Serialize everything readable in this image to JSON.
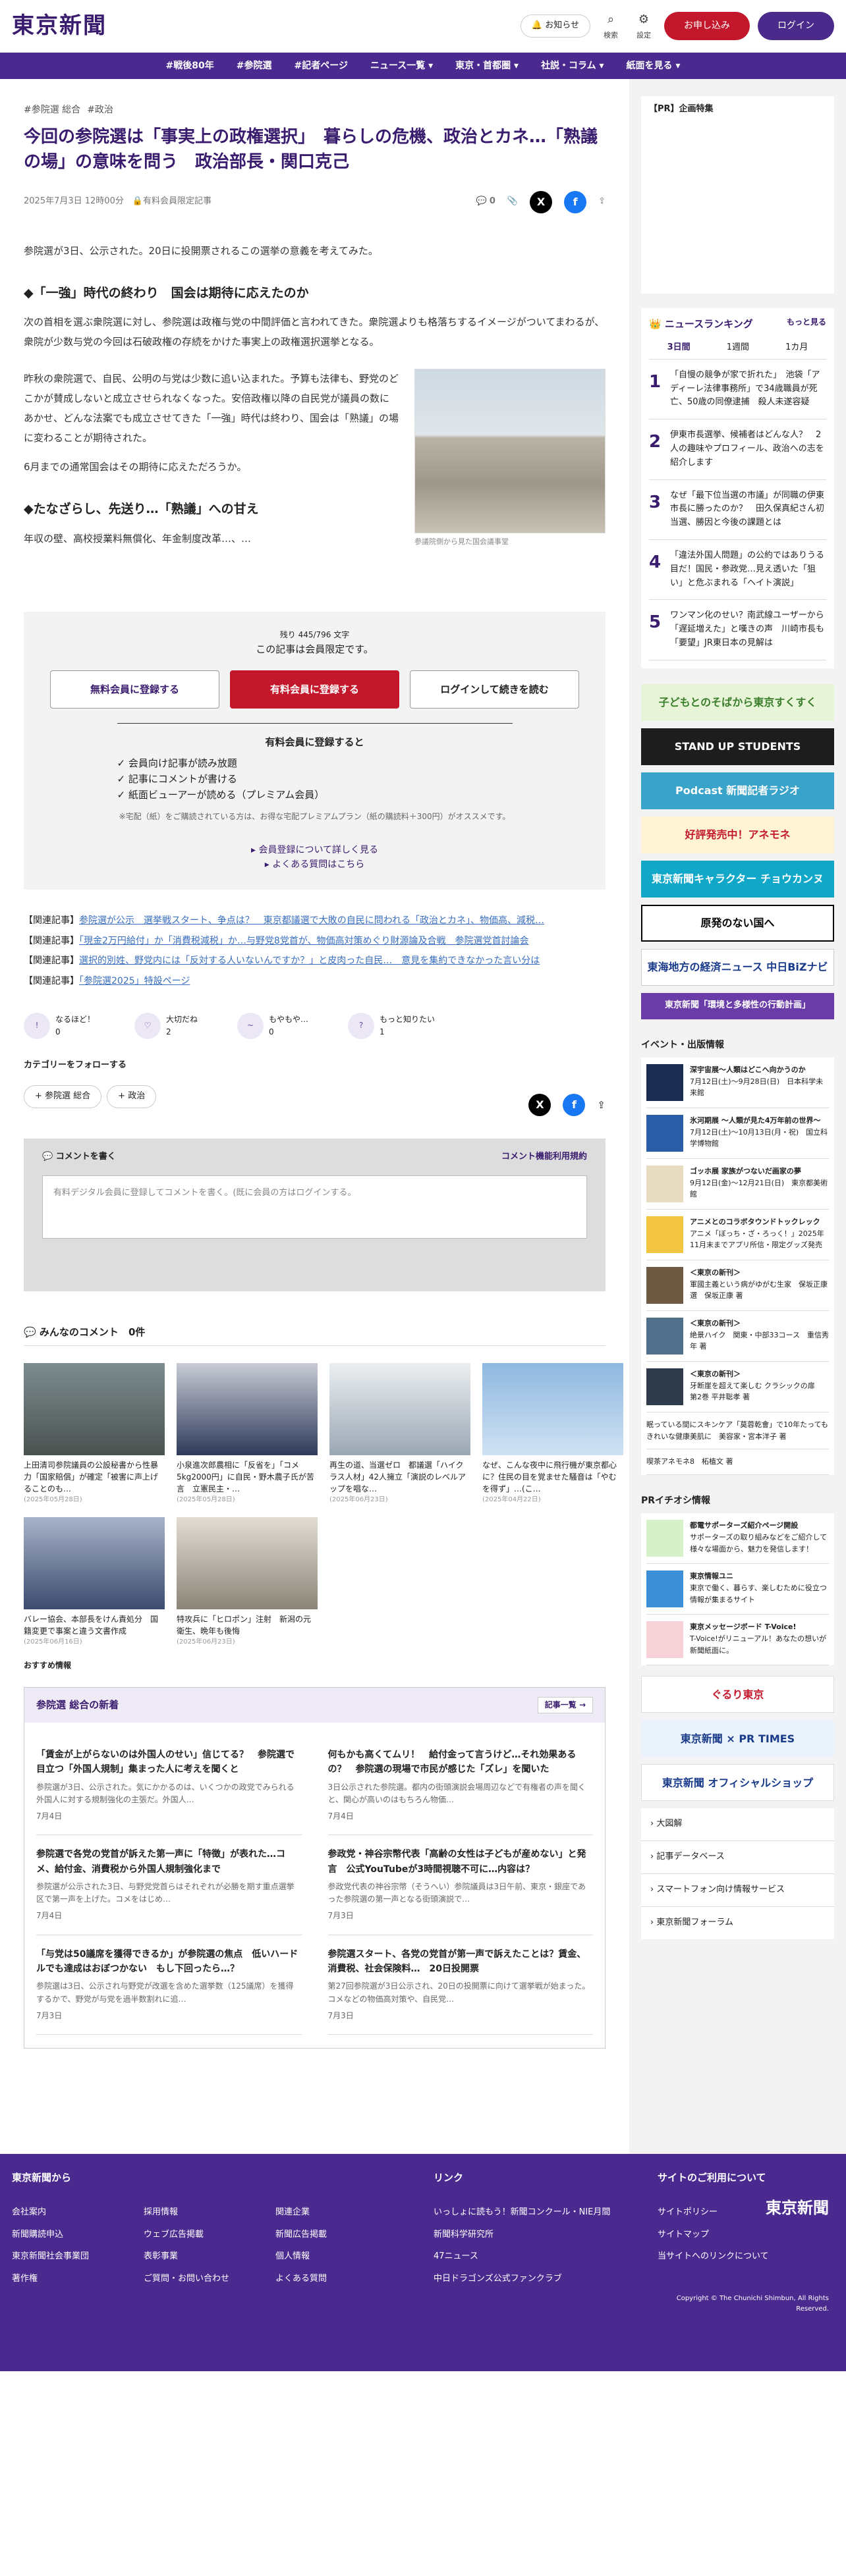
{
  "header": {
    "logo": "東京新聞",
    "notice": "お知らせ",
    "search": "検索",
    "settings": "設定",
    "signup": "お申し込み",
    "login": "ログイン"
  },
  "nav": [
    "#戦後80年",
    "#参院選",
    "#記者ページ",
    "ニュース一覧 ▾",
    "東京・首都圏 ▾",
    "社説・コラム ▾",
    "紙面を見る ▾"
  ],
  "article": {
    "tags": [
      "#参院選 総合",
      "#政治"
    ],
    "title": "今回の参院選は「事実上の政権選択」　暮らしの危機、政治とカネ…「熟議の場」の意味を問う　政治部長・関口克己",
    "date": "2025年7月3日 12時00分",
    "member": "有料会員限定記事",
    "comments": "0",
    "lead": "参院選が3日、公示された。20日に投開票されるこの選挙の意義を考えてみた。",
    "h1": "◆「一強」時代の終わり　国会は期待に応えたのか",
    "p1": "次の首相を選ぶ衆院選に対し、参院選は政権与党の中間評価と言われてきた。衆院選よりも格落ちするイメージがついてまわるが、衆院が少数与党の今回は石破政権の存続をかけた事実上の政権選択選挙となる。",
    "p2": "昨秋の衆院選で、自民、公明の与党は少数に追い込まれた。予算も法律も、野党のどこかが賛成しないと成立させられなくなった。安倍政権以降の自民党が議員の数にあかせ、どんな法案でも成立させてきた「一強」時代は終わり、国会は「熟議」の場に変わることが期待された。",
    "p3": "6月までの通常国会はその期待に応えただろうか。",
    "h2": "◆たなざらし、先送り…「熟議」への甘え",
    "p4": "年収の壁、高校授業料無償化、年金制度改革…、…",
    "caption": "参議院側から見た国会議事堂"
  },
  "paywall": {
    "remain": "残り 445/796 文字",
    "limited": "この記事は会員限定です。",
    "free": "無料会員に登録する",
    "paid": "有料会員に登録する",
    "login": "ログインして続きを読む",
    "feat_title": "有料会員に登録すると",
    "feats": [
      "会員向け記事が読み放題",
      "記事にコメントが書ける",
      "紙面ビューアーが読める（プレミアム会員）"
    ],
    "note": "※宅配（紙）をご購読されている方は、お得な宅配プレミアムプラン（紙の購読料＋300円）がオススメです。",
    "more": "▸ 会員登録について詳しく見る",
    "faq": "▸ よくある質問はこちら"
  },
  "related": [
    {
      "label": "【関連記事】",
      "text": "参院選が公示　選挙戦スタート、争点は？　東京都議選で大敗の自民に問われる「政治とカネ」、物価高、減税…"
    },
    {
      "label": "【関連記事】",
      "text": "「現金2万円給付」か「消費税減税」か…与野党8党首が、物価高対策めぐり財源論及合戦　参院選党首討論会"
    },
    {
      "label": "【関連記事】",
      "text": "選択的別姓、野党内には「反対する人いないんですか？」と皮肉った自民…　意見を集約できなかった言い分は"
    },
    {
      "label": "【関連記事】",
      "text": "「参院選2025」特設ページ"
    }
  ],
  "reactions": [
    {
      "l": "なるほど！",
      "n": "0"
    },
    {
      "l": "大切だね",
      "n": "2"
    },
    {
      "l": "もやもや…",
      "n": "0"
    },
    {
      "l": "もっと知りたい",
      "n": "1"
    }
  ],
  "follow": {
    "title": "カテゴリーをフォローする",
    "items": [
      "+ 参院選 総合",
      "+ 政治"
    ]
  },
  "comment": {
    "title": "コメントを書く",
    "policy": "コメント機能利用規約",
    "body": "有料デジタル会員に登録してコメントを書く。(既に会員の方はログインする。"
  },
  "mycomments": {
    "title": "みんなのコメント",
    "count": "0件"
  },
  "thumbs": [
    {
      "t": "上田清司参院議員の公設秘書から性暴力「国家賠償」が確定「被害に声上げることのも…",
      "d": "(2025年05月28日)"
    },
    {
      "t": "小泉進次郎農相に「反省を」「コメ5kg2000円」に自民・野木農子氏が苦言　立憲民主・…",
      "d": "(2025年05月28日)"
    },
    {
      "t": "再生の道、当選ゼロ　都議選「ハイクラス人材」42人擁立「演説のレベルアップを唱な…",
      "d": "(2025年06月23日)"
    },
    {
      "t": "なぜ、こんな夜中に飛行機が東京都心に？住民の目を覚ませた騒音は「やむを得ず」…(こ…",
      "d": "(2025年04月22日)"
    },
    {
      "t": "バレー協会、本部長をけん責処分　国籍変更で事案と違う文書作成",
      "d": "(2025年06月16日)"
    },
    {
      "t": "特攻兵に「ヒロポン」注射　新潟の元衛生、晩年も後悔",
      "d": "(2025年06月23日)"
    }
  ],
  "recommend": "おすすめ情報",
  "newsbox": {
    "title": "参院選 総合の新着",
    "more": "記事一覧 →",
    "items": [
      {
        "t": "「賃金が上がらないのは外国人のせい」信じてる？　参院選で目立つ「外国人規制」集まった人に考えを聞くと",
        "d": "参院選が3日、公示された。気にかかるのは、いくつかの政党でみられる外国人に対する規制強化の主張だ。外国人…",
        "dt": "7月4日"
      },
      {
        "t": "何もかも高くてムリ！　給付金って言うけど…それ効果あるの？　参院選の現場で市民が感じた「ズレ」を聞いた",
        "d": "3日公示された参院選。都内の街頭演説会場周辺などで有権者の声を聞くと、関心が高いのはもちろん物価…",
        "dt": "7月4日"
      },
      {
        "t": "参院選で各党の党首が訴えた第一声に「特徴」が表れた…コメ、給付金、消費税から外国人規制強化まで",
        "d": "参院選が公示された3日、与野党党首らはそれぞれが必勝を期す重点選挙区で第一声を上げた。コメをはじめ…",
        "dt": "7月4日"
      },
      {
        "t": "参政党・神谷宗幣代表「高齢の女性は子どもが産めない」と発言　公式YouTubeが3時間視聴不可に…内容は？",
        "d": "参政党代表の神谷宗幣（そうへい）参院議員は3日午前、東京・銀座であった参院選の第一声となる街頭演説で…",
        "dt": "7月3日"
      },
      {
        "t": "「与党は50議席を獲得できるか」が参院選の焦点　低いハードルでも達成はおぼつかない　もし下回ったら…？",
        "d": "参院選は3日、公示され与野党が改選を含めた選挙数（125議席）を獲得するかで、野党が与党を過半数割れに追…",
        "dt": "7月3日"
      },
      {
        "t": "参院選スタート、各党の党首が第一声で訴えたことは？賃金、消費税、社会保険料…　20日投開票",
        "d": "第27回参院選が3日公示され、20日の投開票に向けて選挙戦が始まった。コメなどの物価高対策や、自民党…",
        "dt": "7月3日"
      }
    ]
  },
  "side": {
    "pr": "【PR】企画特集",
    "ranking": {
      "title": "ニュースランキング",
      "more": "もっと見る",
      "tabs": [
        "3日間",
        "1週間",
        "1カ月"
      ],
      "items": [
        "「自慢の競争が家で折れた」　池袋「アディーレ法律事務所」で34歳職員が死亡、50歳の同僚逮捕　殺人未遂容疑",
        "伊東市長選挙、候補者はどんな人？　2人の趣味やプロフィール、政治への志を紹介します",
        "なぜ「最下位当選の市議」が同職の伊東市長に勝ったのか？　田久保真紀さん初当選、勝因と今後の課題とは",
        "「違法外国人問題」の公約ではありうる目だ！国民・参政党…見え透いた「狙い」と危ぶまれる「ヘイト演説」",
        "ワンマン化のせい？南武線ユーザーから「遅延増えた」と嘆きの声　川崎市長も「要望」JR東日本の見解は"
      ]
    },
    "banners": [
      "子どもとのそばから東京すくすく",
      "STAND UP STUDENTS",
      "Podcast 新聞記者ラジオ",
      "好評発売中！アネモネ",
      "東京新聞キャラクター チョウカンヌ",
      "原発のない国へ",
      "東海地方の経済ニュース 中日BiZナビ",
      "東京新聞「環境と多様性の行動計画」"
    ],
    "events": {
      "title": "イベント・出版情報",
      "items": [
        {
          "t": "深宇宙展〜人類はどこへ向かうのか",
          "d": "7月12日(土)〜9月28日(日)　日本科学未来館"
        },
        {
          "t": "氷河期展 〜人類が見た4万年前の世界〜",
          "d": "7月12日(土)〜10月13日(月・祝)　国立科学博物館"
        },
        {
          "t": "ゴッホ展 家族がつないだ画家の夢",
          "d": "9月12日(金)〜12月21日(日)　東京都美術館"
        },
        {
          "t": "アニメとのコラボタウンドトックレック",
          "d": "アニメ「ぼっち・ざ・ろっく！」2025年11月末までアプリ所信・限定グッズ発売"
        },
        {
          "t": "＜東京の新刊＞",
          "d": "軍國主義という病がゆがむ生家　保坂正康選　保坂正康 著"
        },
        {
          "t": "＜東京の新刊＞",
          "d": "絶景ハイク　関東・中部33コース　重信秀年 著"
        },
        {
          "t": "＜東京の新刊＞",
          "d": "牙断崖を超えて楽しむ クラシックの扉　第2巻 平井聡孝 著"
        }
      ],
      "extra": [
        "眠っている間にスキンケア「莫蓉乾會」で10年たってもきれいな健康美肌に　美容家・宮本洋子 著",
        "喫茶アネモネ8　柘植文 著"
      ]
    },
    "pr2": {
      "title": "PRイチオシ情報",
      "items": [
        {
          "t": "都電サポーターズ紹介ページ開設",
          "d": "サポーターズの取り組みなどをご紹介して様々な場面から、魅力を発信します！"
        },
        {
          "t": "東京情報ユニ",
          "d": "東京で働く、暮らす、楽しむために役立つ情報が集まるサイト"
        },
        {
          "t": "東京メッセージボード T-Voice!",
          "d": "T-Voice!がリニューアル！あなたの想いが新聞紙面に。"
        }
      ]
    },
    "banners2": [
      "ぐるり東京",
      "東京新聞 × PR TIMES",
      "東京新聞 オフィシャルショップ"
    ],
    "links": [
      "大図解",
      "記事データベース",
      "スマートフォン向け情報サービス",
      "東京新聞フォーラム"
    ]
  },
  "footer": {
    "c1": {
      "title": "東京新聞から",
      "items": [
        "会社案内",
        "新聞購読申込",
        "東京新聞社会事業団",
        "著作権",
        "採用情報",
        "ウェブ広告掲載",
        "表彰事業",
        "ご質問・お問い合わせ",
        "関連企業",
        "新聞広告掲載",
        "個人情報",
        "よくある質問"
      ]
    },
    "c2": {
      "title": "リンク",
      "items": [
        "いっしょに読もう！新聞コンクール・NIE月間",
        "新聞科学研究所",
        "47ニュース",
        "中日ドラゴンズ公式ファンクラブ"
      ]
    },
    "c3": {
      "title": "サイトのご利用について",
      "items": [
        "サイトポリシー",
        "サイトマップ",
        "当サイトへのリンクについて"
      ]
    },
    "logo": "東京新聞",
    "copy": "Copyright © The Chunichi Shimbun, All Rights Reserved."
  }
}
